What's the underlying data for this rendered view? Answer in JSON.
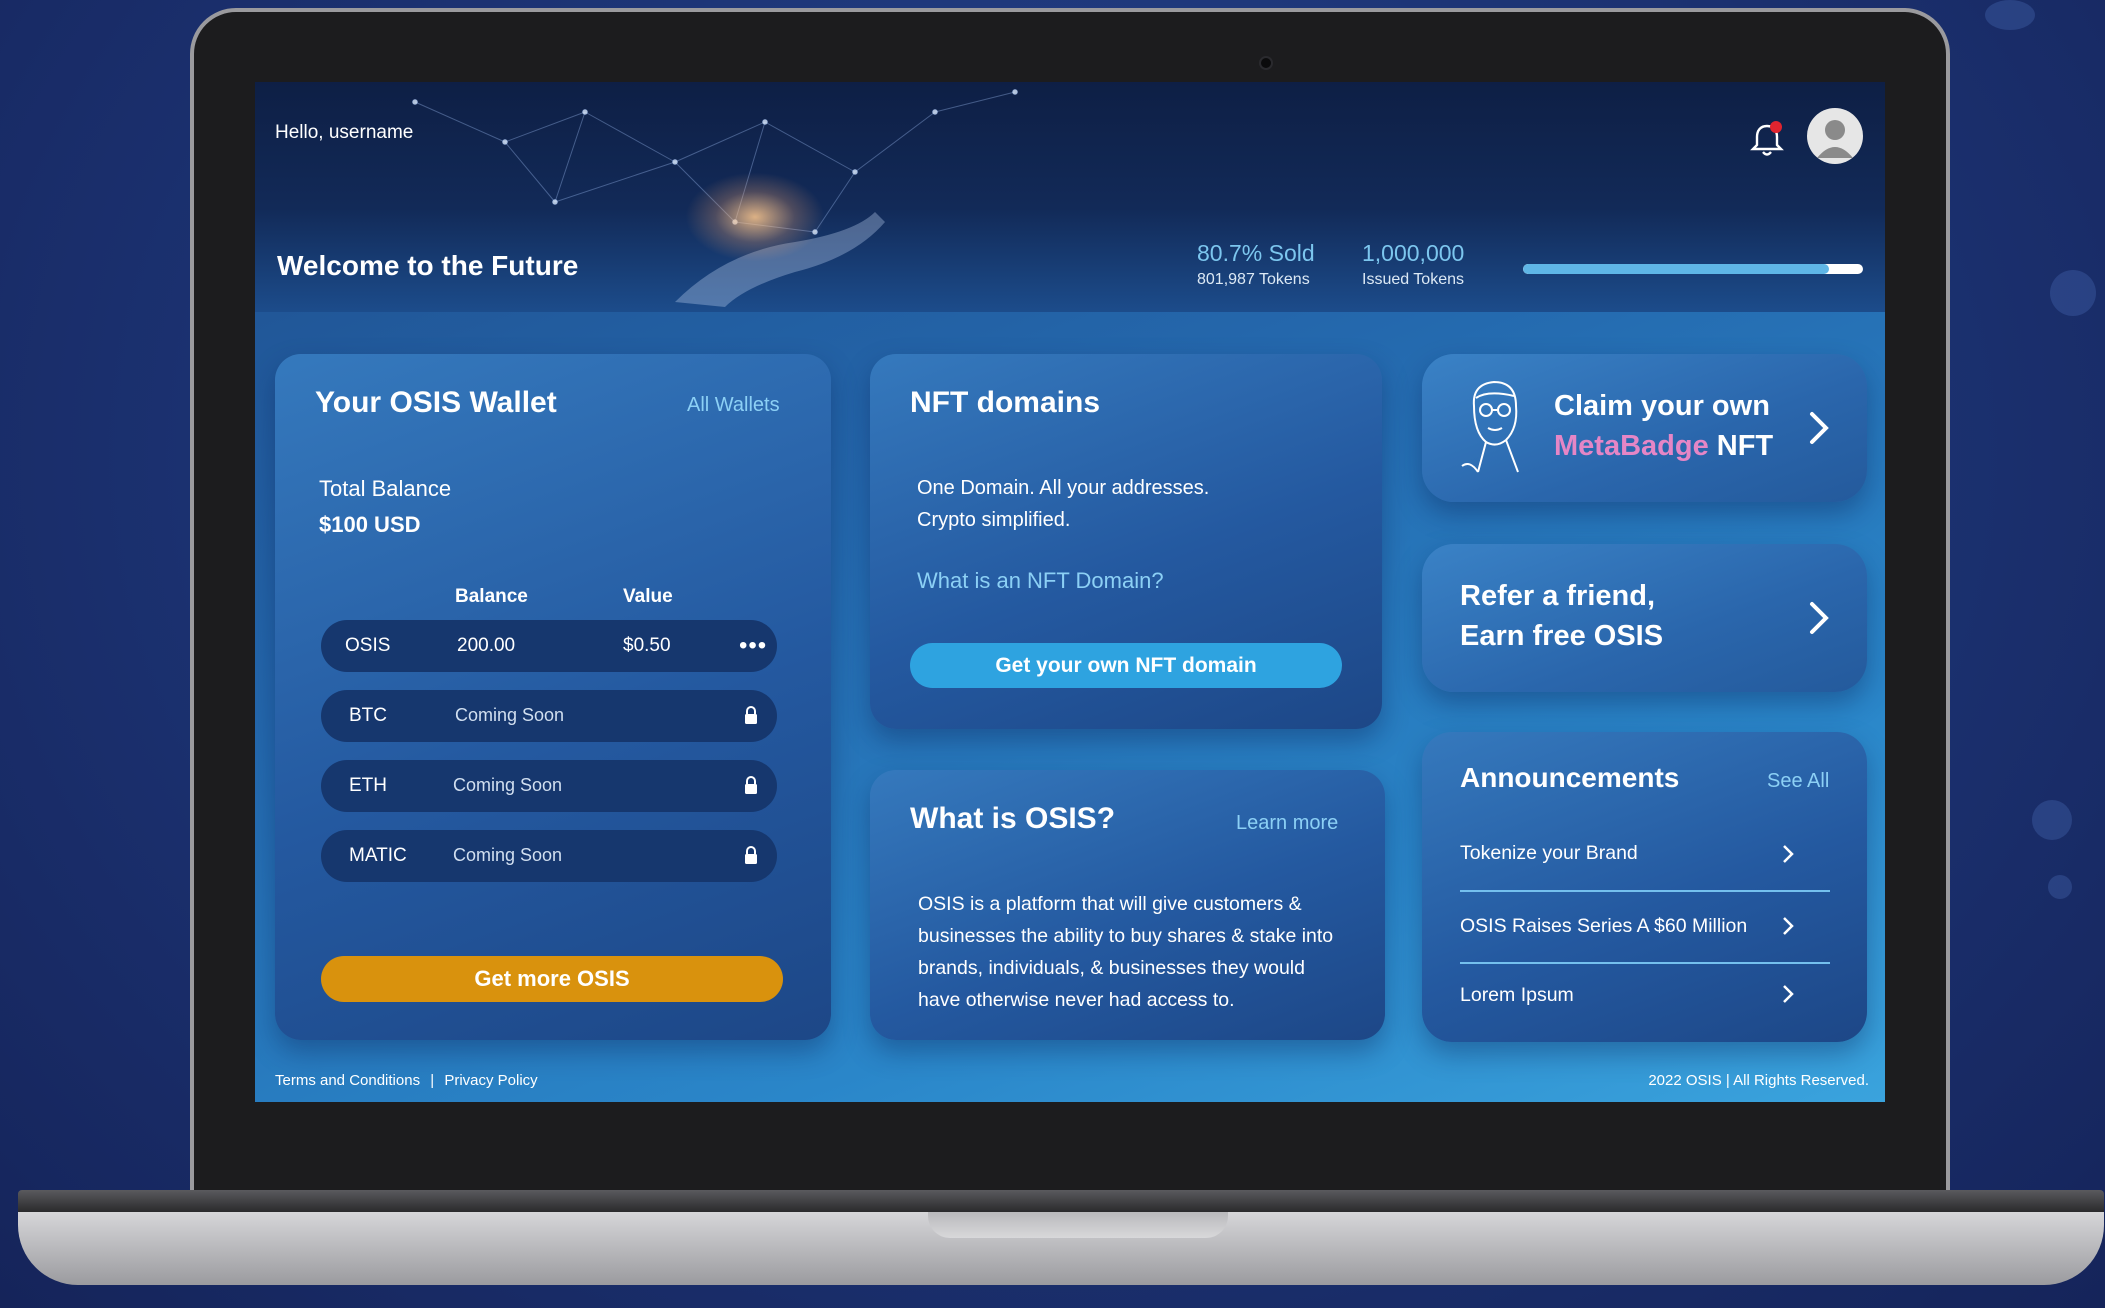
{
  "header": {
    "greeting": "Hello, username",
    "welcome": "Welcome to the Future",
    "sold_percent": "80.7% Sold",
    "sold_tokens": "801,987 Tokens",
    "issued_total": "1,000,000",
    "issued_label": "Issued Tokens",
    "progress_fraction": 0.9
  },
  "wallet": {
    "title": "Your OSIS Wallet",
    "all_wallets": "All Wallets",
    "total_label": "Total Balance",
    "total_value": "$100 USD",
    "col_balance": "Balance",
    "col_value": "Value",
    "rows": [
      {
        "coin": "OSIS",
        "balance": "200.00",
        "value": "$0.50",
        "more": "•••"
      },
      {
        "coin": "BTC",
        "status": "Coming Soon"
      },
      {
        "coin": "ETH",
        "status": "Coming Soon"
      },
      {
        "coin": "MATIC",
        "status": "Coming Soon"
      }
    ],
    "cta": "Get more OSIS"
  },
  "nft": {
    "title": "NFT domains",
    "line1": "One Domain. All your addresses.",
    "line2": "Crypto simplified.",
    "link": "What is an NFT Domain?",
    "cta": "Get your own NFT domain"
  },
  "osis": {
    "title": "What is OSIS?",
    "learn_more": "Learn more",
    "text": "OSIS is a platform that will give customers & businesses the ability to buy shares & stake into brands, individuals, & businesses they would have otherwise never had access to."
  },
  "promo1": {
    "line1": "Claim your own",
    "pink": "MetaBadge",
    "nft": "NFT"
  },
  "promo2": {
    "line1": "Refer a friend,",
    "line2": "Earn free OSIS"
  },
  "announcements": {
    "title": "Announcements",
    "see_all": "See All",
    "items": [
      "Tokenize your Brand",
      "OSIS Raises Series A $60 Million",
      "Lorem Ipsum"
    ]
  },
  "footer": {
    "terms": "Terms and Conditions",
    "sep": "|",
    "privacy": "Privacy Policy",
    "copyright": "2022 OSIS | All Rights Reserved."
  },
  "colors": {
    "accent_gold": "#d9920d",
    "accent_blue": "#2ea3e0",
    "link_blue": "#8cd0f5",
    "pink": "#e586c6"
  },
  "icons": [
    "bell-icon",
    "avatar-icon",
    "lock-icon",
    "chevron-right-icon",
    "more-icon",
    "metabadge-face-icon"
  ]
}
